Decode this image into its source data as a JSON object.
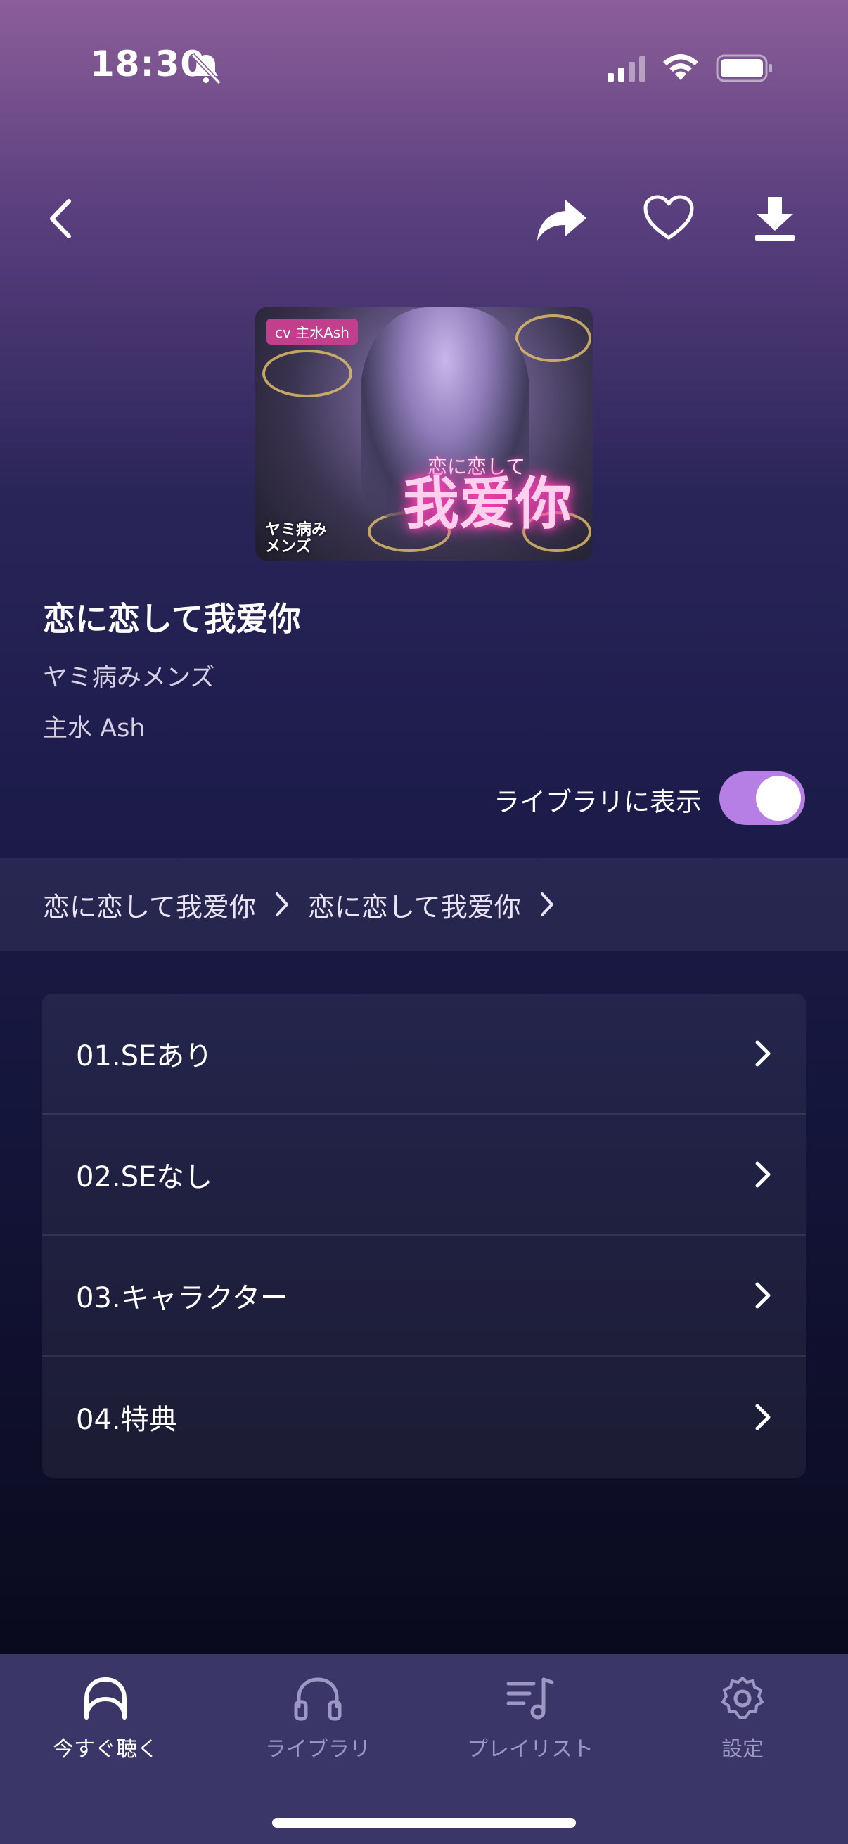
{
  "status_bar": {
    "time": "18:30",
    "icons": [
      "bell-slash-icon",
      "cellular-signal-icon",
      "wifi-icon",
      "battery-icon"
    ]
  },
  "nav": {
    "icons": [
      "back-chevron-icon",
      "share-icon",
      "heart-icon",
      "download-icon"
    ]
  },
  "cover": {
    "cv_tag": "cv 主水Ash",
    "subtitle_text": "恋に恋して",
    "title_text": "我爱你",
    "logo_text_line1": "ヤミ病み",
    "logo_text_line2": "メンズ"
  },
  "album": {
    "title": "恋に恋して我爱你",
    "series": "ヤミ病みメンズ",
    "artist": "主水 Ash"
  },
  "library_toggle": {
    "label": "ライブラリに表示",
    "on": true,
    "accent": "#b57fe6"
  },
  "breadcrumb": {
    "items": [
      "恋に恋して我爱你",
      "恋に恋して我爱你"
    ]
  },
  "tracks": [
    {
      "label": "01.SEあり"
    },
    {
      "label": "02.SEなし"
    },
    {
      "label": "03.キャラクター"
    },
    {
      "label": "04.特典"
    }
  ],
  "tabbar": {
    "tabs": [
      {
        "label": "今すぐ聴く",
        "icon": "listen-now-icon",
        "active": true
      },
      {
        "label": "ライブラリ",
        "icon": "headphones-icon",
        "active": false
      },
      {
        "label": "プレイリスト",
        "icon": "playlist-icon",
        "active": false
      },
      {
        "label": "設定",
        "icon": "gear-icon",
        "active": false
      }
    ]
  }
}
